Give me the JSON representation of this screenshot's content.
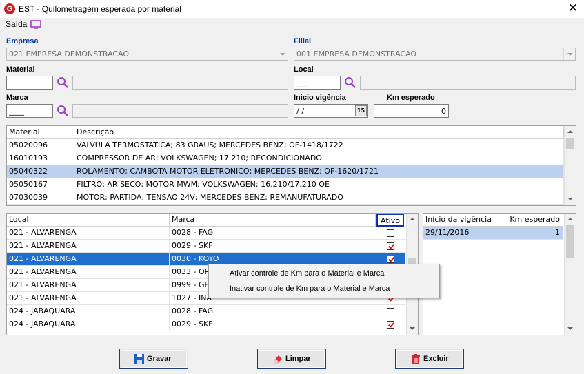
{
  "window": {
    "title": "EST - Quilometragem esperada por material",
    "close_icon": "close-icon"
  },
  "menu": {
    "saida_label": "Saída"
  },
  "form": {
    "empresa": {
      "label": "Empresa",
      "value": "021 EMPRESA DEMONSTRACAO"
    },
    "filial": {
      "label": "Filial",
      "value": "001 EMPRESA DEMONSTRACAO"
    },
    "material": {
      "label": "Material",
      "value": "",
      "description": ""
    },
    "local": {
      "label": "Local",
      "value": "___",
      "description": ""
    },
    "marca": {
      "label": "Marca",
      "value": "____",
      "description": ""
    },
    "inicio_vigencia": {
      "label": "Inicio vigência",
      "value": " / /",
      "cal_label": "15"
    },
    "km_esperado": {
      "label": "Km esperado",
      "value": "0"
    }
  },
  "materials_grid": {
    "columns": [
      "Material",
      "Descrição"
    ],
    "rows": [
      {
        "material": "05020096",
        "descricao": "VALVULA TERMOSTATICA; 83 GRAUS; MERCEDES BENZ; OF-1418/1722"
      },
      {
        "material": "16010193",
        "descricao": "COMPRESSOR DE AR; VOLKSWAGEN; 17.210; RECONDICIONADO"
      },
      {
        "material": "05040322",
        "descricao": "ROLAMENTO; CAMBOTA MOTOR ELETRONICO; MERCEDES BENZ; OF-1620/1721"
      },
      {
        "material": "05050167",
        "descricao": "FILTRO; AR SECO; MOTOR MWM; VOLKSWAGEN; 16.210/17.210 OE"
      },
      {
        "material": "07030039",
        "descricao": "MOTOR; PARTIDA; TENSAO 24V; MERCEDES BENZ; REMANUFATURADO"
      }
    ]
  },
  "local_grid": {
    "columns": [
      "Local",
      "Marca",
      "Ativo"
    ],
    "rows": [
      {
        "local": "021 - ALVARENGA",
        "marca": "0028 - FAG",
        "ativo": false
      },
      {
        "local": "021 - ALVARENGA",
        "marca": "0029 - SKF",
        "ativo": true
      },
      {
        "local": "021 - ALVARENGA",
        "marca": "0030 - KOYO",
        "ativo": true
      },
      {
        "local": "021 - ALVARENGA",
        "marca": "0033 - OR",
        "ativo": true
      },
      {
        "local": "021 - ALVARENGA",
        "marca": "0999 - GE",
        "ativo": true
      },
      {
        "local": "021 - ALVARENGA",
        "marca": "1027 - INA",
        "ativo": true
      },
      {
        "local": "024 - JABAQUARA",
        "marca": "0028 - FAG",
        "ativo": false
      },
      {
        "local": "024 - JABAQUARA",
        "marca": "0029 - SKF",
        "ativo": true
      }
    ]
  },
  "vigencia_grid": {
    "columns": [
      "Início da vigência",
      "Km esperado"
    ],
    "rows": [
      {
        "inicio": "29/11/2016",
        "km": "1"
      }
    ]
  },
  "context_menu": {
    "items": [
      "Ativar controle de Km para o Material e Marca",
      "Inativar controle de Km para o Material e Marca"
    ]
  },
  "buttons": {
    "gravar": "Gravar",
    "limpar": "Limpar",
    "excluir": "Excluir"
  },
  "colors": {
    "selection_light": "#bcd0ef",
    "selection_dark": "#1f6fcf",
    "label_blue": "#003399",
    "accent_purple": "#a040c0"
  }
}
